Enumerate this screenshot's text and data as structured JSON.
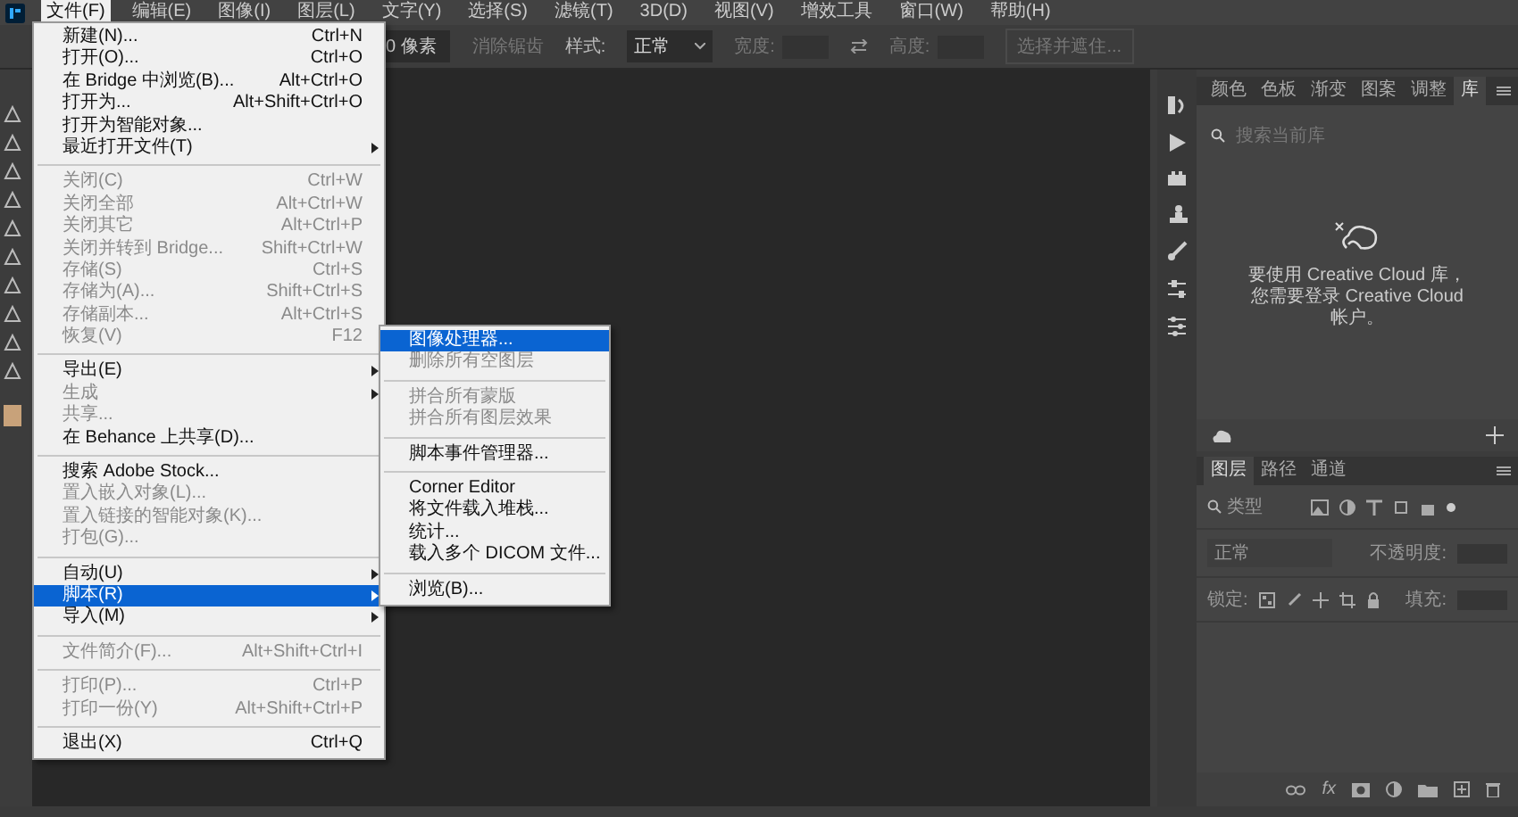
{
  "menubar": [
    {
      "label": "文件(F)",
      "selected": true
    },
    {
      "label": "编辑(E)",
      "selected": false
    },
    {
      "label": "图像(I)",
      "selected": false
    },
    {
      "label": "图层(L)",
      "selected": false
    },
    {
      "label": "文字(Y)",
      "selected": false
    },
    {
      "label": "选择(S)",
      "selected": false
    },
    {
      "label": "滤镜(T)",
      "selected": false
    },
    {
      "label": "3D(D)",
      "selected": false
    },
    {
      "label": "视图(V)",
      "selected": false
    },
    {
      "label": "增效工具",
      "selected": false
    },
    {
      "label": "窗口(W)",
      "selected": false
    },
    {
      "label": "帮助(H)",
      "selected": false
    }
  ],
  "options_bar": {
    "feather_value": "0 像素",
    "antialias": {
      "label": "消除锯齿",
      "disabled": true
    },
    "style_label": "样式:",
    "style_value": "正常",
    "width_label": "宽度:",
    "height_label": "高度:",
    "select_and_mask": {
      "label": "选择并遮住...",
      "disabled": true
    }
  },
  "file_menu": [
    {
      "kind": "item",
      "label": "新建(N)...",
      "shortcut": "Ctrl+N",
      "disabled": false,
      "submenu": false,
      "selected": false
    },
    {
      "kind": "item",
      "label": "打开(O)...",
      "shortcut": "Ctrl+O",
      "disabled": false,
      "submenu": false,
      "selected": false
    },
    {
      "kind": "item",
      "label": "在 Bridge 中浏览(B)...",
      "shortcut": "Alt+Ctrl+O",
      "disabled": false,
      "submenu": false,
      "selected": false
    },
    {
      "kind": "item",
      "label": "打开为...",
      "shortcut": "Alt+Shift+Ctrl+O",
      "disabled": false,
      "submenu": false,
      "selected": false
    },
    {
      "kind": "item",
      "label": "打开为智能对象...",
      "disabled": false,
      "submenu": false,
      "selected": false
    },
    {
      "kind": "item",
      "label": "最近打开文件(T)",
      "disabled": false,
      "submenu": true,
      "selected": false
    },
    {
      "kind": "separator"
    },
    {
      "kind": "item",
      "label": "关闭(C)",
      "shortcut": "Ctrl+W",
      "disabled": true,
      "submenu": false,
      "selected": false
    },
    {
      "kind": "item",
      "label": "关闭全部",
      "shortcut": "Alt+Ctrl+W",
      "disabled": true,
      "submenu": false,
      "selected": false
    },
    {
      "kind": "item",
      "label": "关闭其它",
      "shortcut": "Alt+Ctrl+P",
      "disabled": true,
      "submenu": false,
      "selected": false
    },
    {
      "kind": "item",
      "label": "关闭并转到 Bridge...",
      "shortcut": "Shift+Ctrl+W",
      "disabled": true,
      "submenu": false,
      "selected": false
    },
    {
      "kind": "item",
      "label": "存储(S)",
      "shortcut": "Ctrl+S",
      "disabled": true,
      "submenu": false,
      "selected": false
    },
    {
      "kind": "item",
      "label": "存储为(A)...",
      "shortcut": "Shift+Ctrl+S",
      "disabled": true,
      "submenu": false,
      "selected": false
    },
    {
      "kind": "item",
      "label": "存储副本...",
      "shortcut": "Alt+Ctrl+S",
      "disabled": true,
      "submenu": false,
      "selected": false
    },
    {
      "kind": "item",
      "label": "恢复(V)",
      "shortcut": "F12",
      "disabled": true,
      "submenu": false,
      "selected": false
    },
    {
      "kind": "separator"
    },
    {
      "kind": "item",
      "label": "导出(E)",
      "disabled": false,
      "submenu": true,
      "selected": false
    },
    {
      "kind": "item",
      "label": "生成",
      "disabled": true,
      "submenu": true,
      "selected": false
    },
    {
      "kind": "item",
      "label": "共享...",
      "disabled": true,
      "submenu": false,
      "selected": false
    },
    {
      "kind": "item",
      "label": "在 Behance 上共享(D)...",
      "disabled": false,
      "submenu": false,
      "selected": false
    },
    {
      "kind": "separator"
    },
    {
      "kind": "item",
      "label": "搜索 Adobe Stock...",
      "disabled": false,
      "submenu": false,
      "selected": false
    },
    {
      "kind": "item",
      "label": "置入嵌入对象(L)...",
      "disabled": true,
      "submenu": false,
      "selected": false
    },
    {
      "kind": "item",
      "label": "置入链接的智能对象(K)...",
      "disabled": true,
      "submenu": false,
      "selected": false
    },
    {
      "kind": "item",
      "label": "打包(G)...",
      "disabled": true,
      "submenu": false,
      "selected": false
    },
    {
      "kind": "separator"
    },
    {
      "kind": "item",
      "label": "自动(U)",
      "disabled": false,
      "submenu": true,
      "selected": false
    },
    {
      "kind": "item",
      "label": "脚本(R)",
      "disabled": false,
      "submenu": true,
      "selected": true
    },
    {
      "kind": "item",
      "label": "导入(M)",
      "disabled": false,
      "submenu": true,
      "selected": false
    },
    {
      "kind": "separator"
    },
    {
      "kind": "item",
      "label": "文件简介(F)...",
      "shortcut": "Alt+Shift+Ctrl+I",
      "disabled": true,
      "submenu": false,
      "selected": false
    },
    {
      "kind": "separator"
    },
    {
      "kind": "item",
      "label": "打印(P)...",
      "shortcut": "Ctrl+P",
      "disabled": true,
      "submenu": false,
      "selected": false
    },
    {
      "kind": "item",
      "label": "打印一份(Y)",
      "shortcut": "Alt+Shift+Ctrl+P",
      "disabled": true,
      "submenu": false,
      "selected": false
    },
    {
      "kind": "separator"
    },
    {
      "kind": "item",
      "label": "退出(X)",
      "shortcut": "Ctrl+Q",
      "disabled": false,
      "submenu": false,
      "selected": false
    }
  ],
  "scripts_submenu": [
    {
      "kind": "item",
      "label": "图像处理器...",
      "disabled": false,
      "selected": true
    },
    {
      "kind": "item",
      "label": "删除所有空图层",
      "disabled": true,
      "selected": false
    },
    {
      "kind": "separator"
    },
    {
      "kind": "item",
      "label": "拼合所有蒙版",
      "disabled": true,
      "selected": false
    },
    {
      "kind": "item",
      "label": "拼合所有图层效果",
      "disabled": true,
      "selected": false
    },
    {
      "kind": "separator"
    },
    {
      "kind": "item",
      "label": "脚本事件管理器...",
      "disabled": false,
      "selected": false
    },
    {
      "kind": "separator"
    },
    {
      "kind": "item",
      "label": "Corner Editor",
      "disabled": false,
      "selected": false
    },
    {
      "kind": "item",
      "label": "将文件载入堆栈...",
      "disabled": false,
      "selected": false
    },
    {
      "kind": "item",
      "label": "统计...",
      "disabled": false,
      "selected": false
    },
    {
      "kind": "item",
      "label": "载入多个 DICOM 文件...",
      "disabled": false,
      "selected": false
    },
    {
      "kind": "separator"
    },
    {
      "kind": "item",
      "label": "浏览(B)...",
      "disabled": false,
      "selected": false
    }
  ],
  "libraries_panel": {
    "tabs": [
      {
        "label": "颜色",
        "selected": false
      },
      {
        "label": "色板",
        "selected": false
      },
      {
        "label": "渐变",
        "selected": false
      },
      {
        "label": "图案",
        "selected": false
      },
      {
        "label": "调整",
        "selected": false
      },
      {
        "label": "库",
        "selected": true
      }
    ],
    "search": {
      "placeholder": "搜索当前库"
    },
    "message": "要使用 Creative Cloud 库，您需要登录 Creative Cloud 帐户。"
  },
  "layers_panel": {
    "tabs": [
      {
        "label": "图层",
        "selected": true
      },
      {
        "label": "路径",
        "selected": false
      },
      {
        "label": "通道",
        "selected": false
      }
    ],
    "filter": {
      "placeholder": "类型"
    },
    "blend_mode": "正常",
    "opacity_label": "不透明度:",
    "lock_label": "锁定:",
    "fill_label": "填充:",
    "fx_label": "fx"
  }
}
